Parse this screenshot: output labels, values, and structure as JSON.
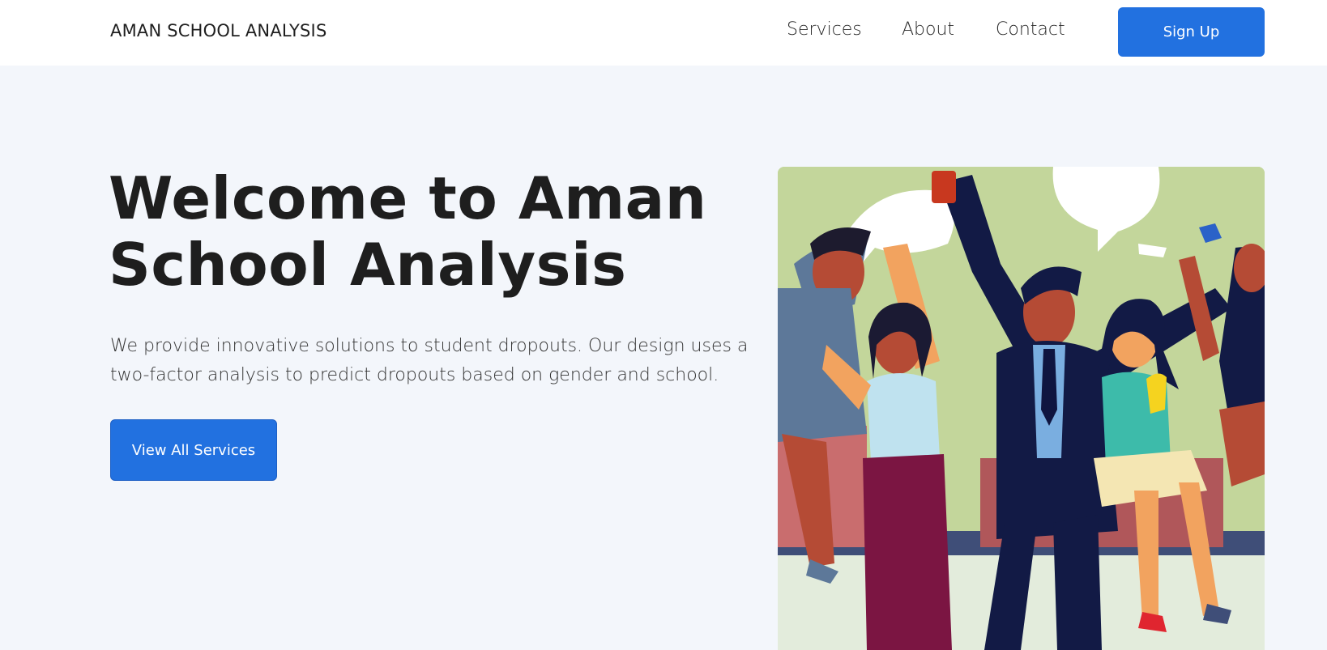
{
  "header": {
    "brand": "AMAN SCHOOL ANALYSIS",
    "nav": [
      {
        "label": "Services"
      },
      {
        "label": "About"
      },
      {
        "label": "Contact"
      }
    ],
    "signup_label": "Sign Up"
  },
  "hero": {
    "title_line1": "Welcome to Aman",
    "title_line2": "School Analysis",
    "description_line1": "We provide innovative solutions to student dropouts. Our design uses a",
    "description_line2": "two-factor analysis to predict dropouts based on gender and school.",
    "cta_label": "View All Services",
    "image_alt": "Illustration of cheering students celebrating"
  },
  "colors": {
    "accent": "#2271e0",
    "page_bg": "#f3f6fb",
    "header_bg": "#ffffff",
    "text": "#1e1e1e"
  }
}
